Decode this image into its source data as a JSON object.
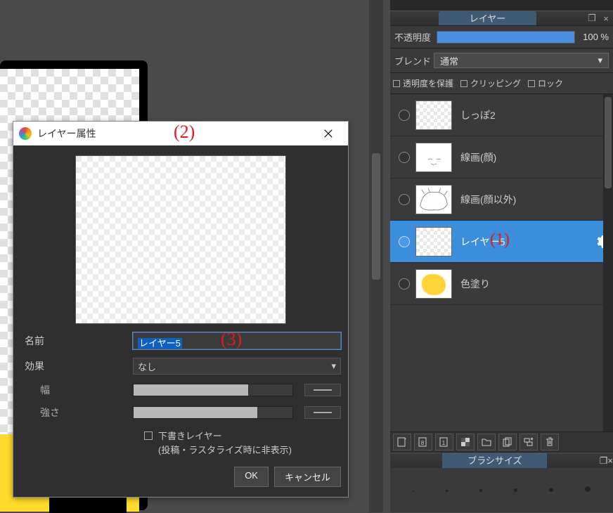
{
  "dialog": {
    "title": "レイヤー属性",
    "marker": "(2)",
    "labels": {
      "name": "名前",
      "effect": "効果",
      "width": "幅",
      "strength": "強さ",
      "draft_line1": "下書きレイヤー",
      "draft_line2": "(投稿・ラスタライズ時に非表示)"
    },
    "name_value": "レイヤー5",
    "name_marker": "(3)",
    "effect_value": "なし",
    "width_fill_pct": 72,
    "strength_fill_pct": 78,
    "buttons": {
      "ok": "OK",
      "cancel": "キャンセル"
    }
  },
  "panel": {
    "title": "レイヤー",
    "opacity_label": "不透明度",
    "opacity_pct": 100,
    "opacity_display": "100 %",
    "blend_label": "ブレンド",
    "blend_value": "通常",
    "options": {
      "protect_alpha": "透明度を保護",
      "clipping": "クリッピング",
      "lock": "ロック"
    },
    "layers": [
      {
        "name": "しっぽ2",
        "selected": false,
        "thumb": "blank"
      },
      {
        "name": "線画(顔)",
        "selected": false,
        "thumb": "lines1"
      },
      {
        "name": "線画(顔以外)",
        "selected": false,
        "thumb": "lines2"
      },
      {
        "name": "レイヤー5",
        "selected": true,
        "thumb": "blank",
        "marker": "(1)"
      },
      {
        "name": "色塗り",
        "selected": false,
        "thumb": "yellow"
      }
    ],
    "brush_title": "ブラシサイズ",
    "brush_sizes": [
      2,
      3,
      4,
      5,
      6,
      8
    ]
  }
}
